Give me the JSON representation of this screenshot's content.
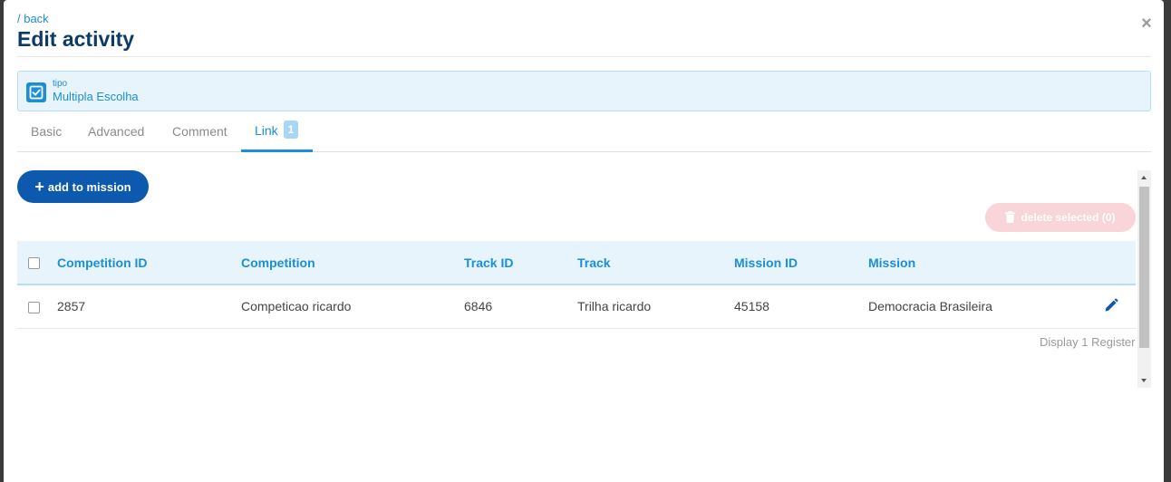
{
  "header": {
    "back_label": "/ back",
    "title": "Edit activity",
    "close_symbol": "×"
  },
  "type_field": {
    "label": "tipo",
    "value": "Multipla Escolha",
    "icon": "checkbox-icon"
  },
  "tabs": [
    {
      "label": "Basic",
      "active": false
    },
    {
      "label": "Advanced",
      "active": false
    },
    {
      "label": "Comment",
      "active": false
    },
    {
      "label": "Link",
      "active": true,
      "badge": "1"
    }
  ],
  "actions": {
    "add_label": "add to mission",
    "delete_label": "delete selected (0)"
  },
  "table": {
    "columns": [
      "Competition ID",
      "Competition",
      "Track ID",
      "Track",
      "Mission ID",
      "Mission"
    ],
    "rows": [
      [
        "2857",
        "Competicao ricardo",
        "6846",
        "Trilha ricardo",
        "45158",
        "Democracia Brasileira"
      ]
    ]
  },
  "footer": {
    "display_text": "Display 1 Register"
  },
  "colors": {
    "accent": "#1a8fd8",
    "primary_button": "#0c59ad",
    "title": "#0d3b66",
    "danger_disabled": "#f9d4d8"
  }
}
